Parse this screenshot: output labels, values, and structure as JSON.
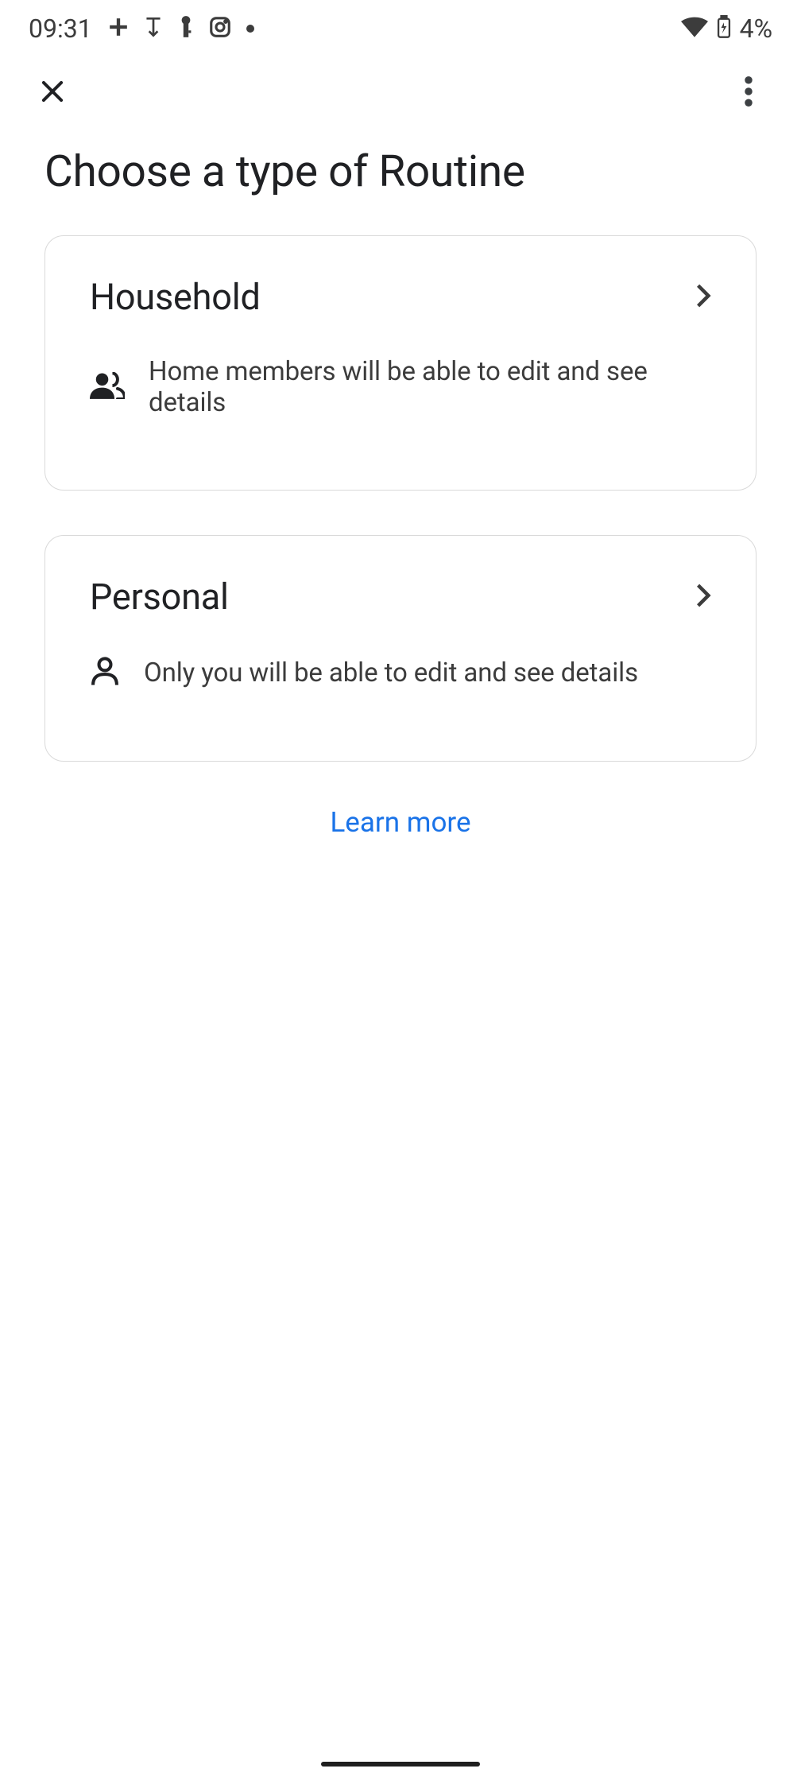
{
  "status_bar": {
    "time": "09:31",
    "battery": "4%"
  },
  "page": {
    "title": "Choose a type of Routine"
  },
  "options": {
    "household": {
      "title": "Household",
      "description": "Home members will be able to edit and see details"
    },
    "personal": {
      "title": "Personal",
      "description": "Only you will be able to edit and see details"
    }
  },
  "links": {
    "learn_more": "Learn more"
  }
}
